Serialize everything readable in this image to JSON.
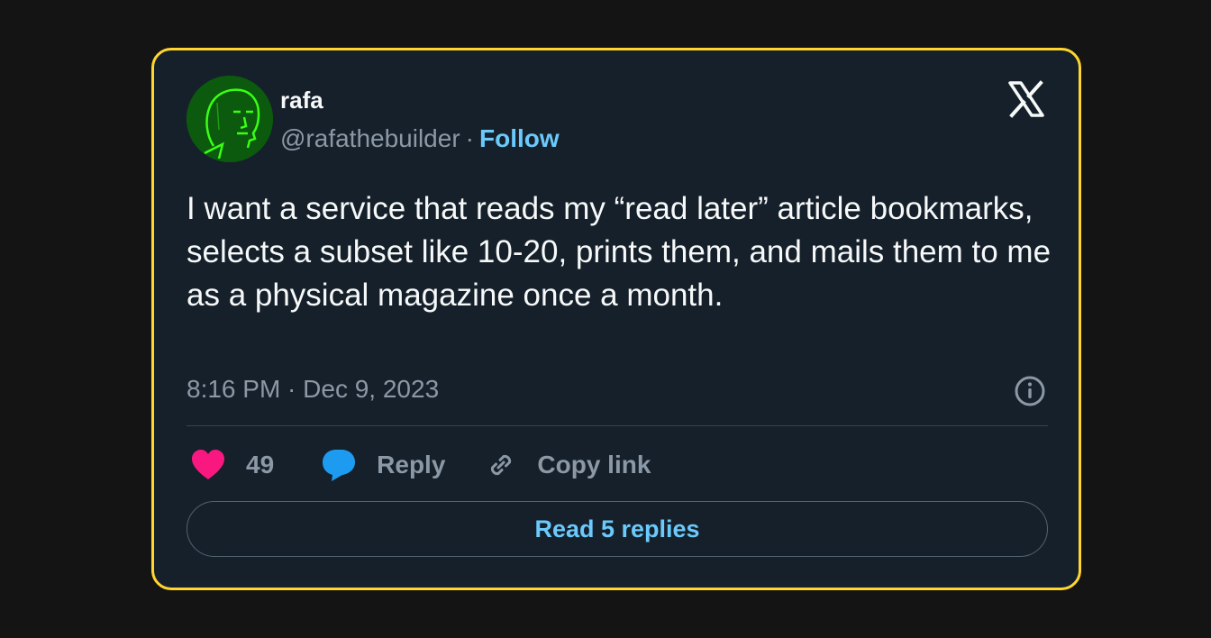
{
  "author": {
    "display_name": "rafa",
    "handle": "@rafathebuilder",
    "separator": "·",
    "follow_label": "Follow"
  },
  "tweet": {
    "text": "I want a service that reads my “read later” article bookmarks, selects a subset like 10-20, prints them, and mails them to me as a physical magazine once a month.",
    "timestamp": "8:16 PM · Dec 9, 2023"
  },
  "actions": {
    "likes_count": "49",
    "reply_label": "Reply",
    "copy_link_label": "Copy link"
  },
  "read_replies_label": "Read 5 replies",
  "icons": {
    "logo": "x-logo-icon",
    "info": "info-icon",
    "like": "heart-icon",
    "reply": "speech-bubble-icon",
    "copy": "link-icon"
  },
  "colors": {
    "card_bg": "#15202b",
    "card_border": "#ffd52e",
    "accent_link": "#6bc9fb",
    "heart": "#f91880",
    "reply_bubble": "#1d9bf0",
    "muted_text": "#8b98a5",
    "avatar_bg": "#0c5a0e"
  }
}
